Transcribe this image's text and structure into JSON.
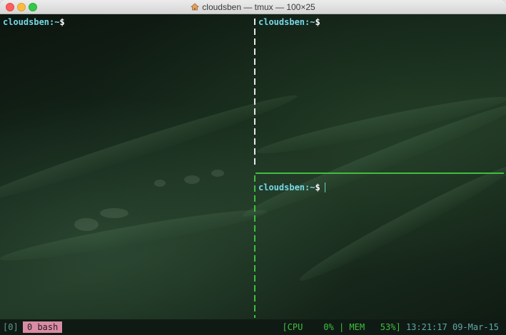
{
  "window": {
    "title": "cloudsben — tmux — 100×25"
  },
  "panes": {
    "left": {
      "prompt": "cloudsben:~",
      "symbol": "$"
    },
    "top_right": {
      "prompt": "cloudsben:~",
      "symbol": "$"
    },
    "bottom_right": {
      "prompt": "cloudsben:~",
      "symbol": "$",
      "active": true
    }
  },
  "status_bar": {
    "session_index": "[0]",
    "window_tab": "0 bash",
    "cpu_label": "[CPU",
    "cpu_value": "0%",
    "separator": "|",
    "mem_label": "MEM",
    "mem_value": "53%]",
    "time": "13:21:17",
    "date": "09-Mar-15"
  },
  "colors": {
    "prompt": "#77d8e6",
    "active_border": "#3fbf3f",
    "window_tab_bg": "#d98ca4"
  }
}
